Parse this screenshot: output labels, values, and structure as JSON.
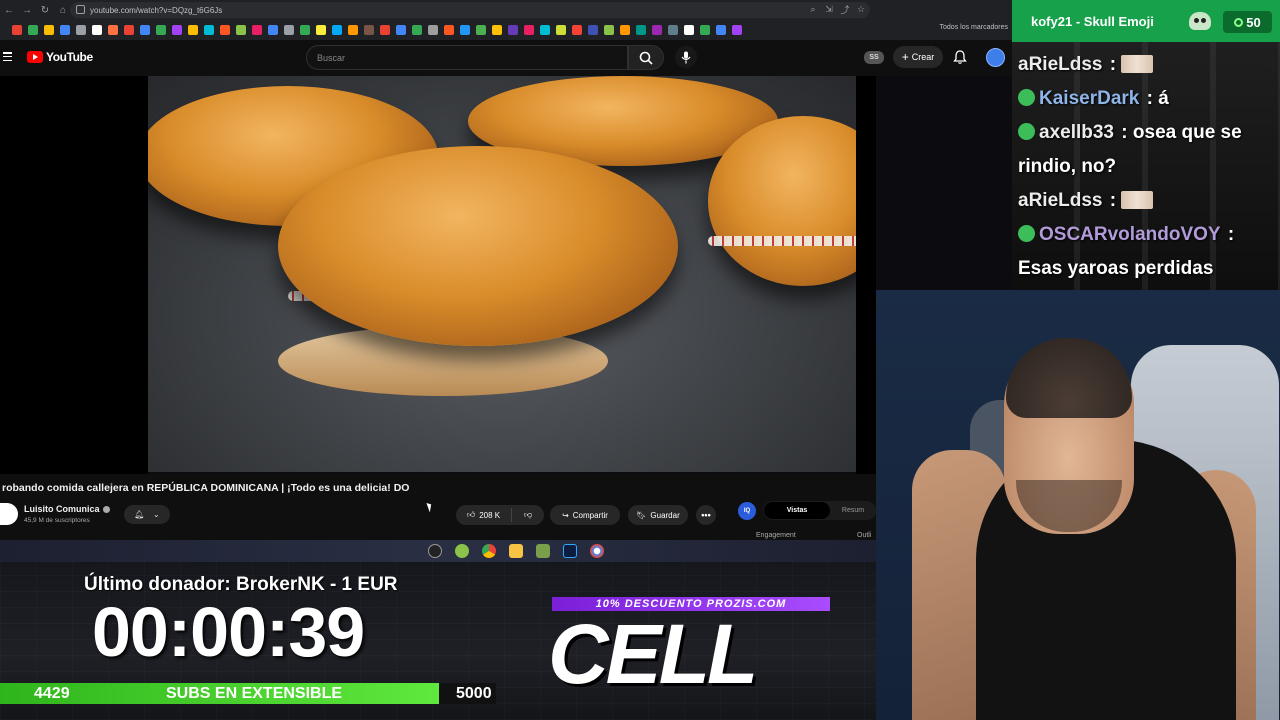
{
  "browser": {
    "url": "youtube.com/watch?v=DQzg_t6G6Js",
    "bookmarks_all": "Todos los marcadores",
    "bookmark_colors": [
      "#e94235",
      "#34a853",
      "#fbbc04",
      "#4285f4",
      "#9aa0a6",
      "#ffffff",
      "#ff7043",
      "#ea4335",
      "#4285f4",
      "#34a853",
      "#a142f4",
      "#fbbc04",
      "#00bcd4",
      "#ff5722",
      "#8bc34a",
      "#e91e63",
      "#4285f4",
      "#9aa0a6",
      "#34a853",
      "#ffeb3b",
      "#03a9f4",
      "#ff9800",
      "#795548",
      "#e94235",
      "#4285f4",
      "#34a853",
      "#9e9e9e",
      "#ff5722",
      "#2196f3",
      "#4caf50",
      "#ffc107",
      "#673ab7",
      "#e91e63",
      "#00bcd4",
      "#cddc39",
      "#f44336",
      "#3f51b5",
      "#8bc34a",
      "#ff9800",
      "#009688",
      "#9c27b0",
      "#607d8b",
      "#ffffff",
      "#34a853",
      "#4285f4",
      "#a142f4"
    ]
  },
  "youtube": {
    "logo_text": "YouTube",
    "search_placeholder": "Buscar",
    "ss_badge": "SS",
    "create_label": "Crear",
    "video_title": "robando comida callejera en REPÚBLICA DOMINICANA | ¡Todo es una delicia! DO",
    "channel_name": "Luisito Comunica",
    "subscribers": "45,9 M de suscriptores",
    "likes": "208 K",
    "share_label": "Compartir",
    "save_label": "Guardar",
    "more_label": "•••",
    "ext_logo": "IQ",
    "ext_tab_active": "Vistas",
    "ext_tab_other": "Resum",
    "ext_sub_left": "Engagement",
    "ext_sub_right": "Outli"
  },
  "overlay": {
    "donor": "Último donador: BrokerNK - 1 EUR",
    "timer": "00:00:39",
    "subs_current": "4429",
    "subs_label": "SUBS EN EXTENSIBLE",
    "subs_goal": "5000",
    "subs_progress": 0.886,
    "promo": "10% DESCUENTO PROZIS.COM",
    "brand": "CELL"
  },
  "chat": {
    "header_user": "kofy21",
    "header_reward": "- Skull Emoji",
    "points": "50",
    "messages": [
      {
        "user": "aRieLdss",
        "sep": " : ",
        "text": ""
      },
      {
        "user": "KaiserDark",
        "sep": " : ",
        "text": "á"
      },
      {
        "user": "axellb33",
        "sep": " : ",
        "text": "osea que se rindio, no?"
      },
      {
        "user": "aRieLdss",
        "sep": " : ",
        "text": ""
      },
      {
        "user": "OSCARvolandoVOY",
        "sep": " : ",
        "text": "Esas yaroas perdidas"
      }
    ]
  }
}
